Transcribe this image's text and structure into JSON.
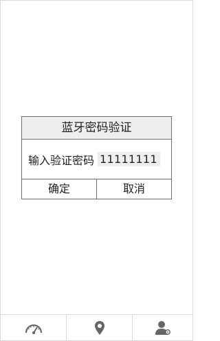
{
  "dialog": {
    "title": "蓝牙密码验证",
    "password_label": "输入验证密码",
    "password_value": "11111111",
    "confirm_label": "确定",
    "cancel_label": "取消"
  },
  "bottom_nav": {
    "items": [
      {
        "icon": "speedometer-icon"
      },
      {
        "icon": "location-pin-icon"
      },
      {
        "icon": "user-settings-icon"
      }
    ]
  },
  "colors": {
    "dialog_title_bg": "#eeeeee",
    "border": "#6e6e6e",
    "icon": "#666666"
  }
}
